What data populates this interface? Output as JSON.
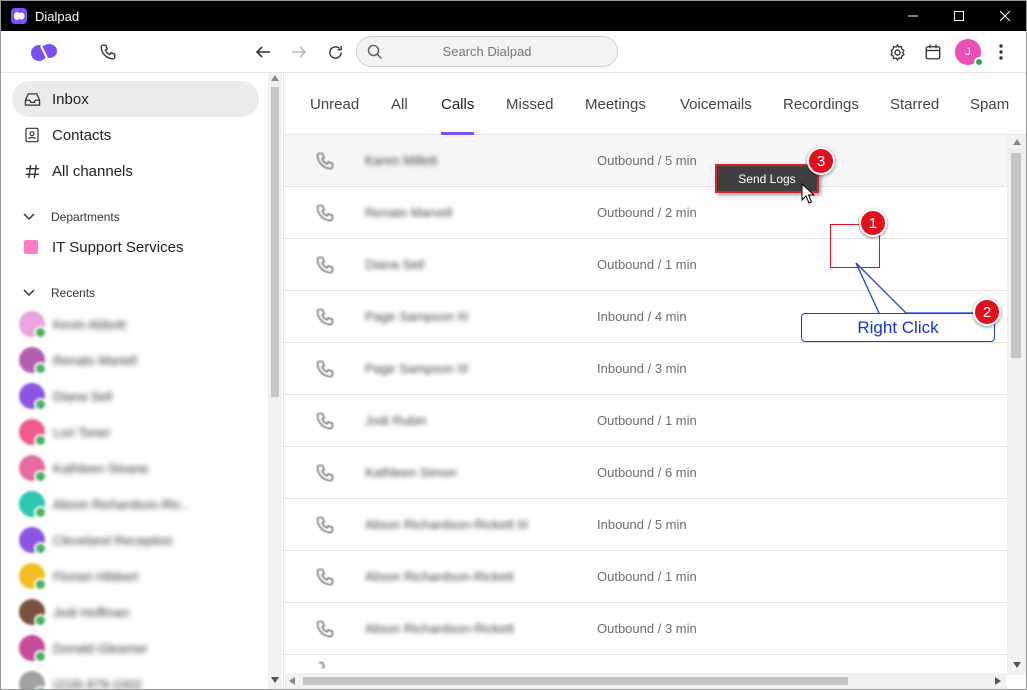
{
  "window": {
    "title": "Dialpad",
    "controls": [
      "minimize",
      "maximize",
      "close"
    ]
  },
  "toolbar": {
    "search_placeholder": "Search Dialpad",
    "avatar_initial": "J"
  },
  "sidebar": {
    "nav": [
      {
        "label": "Inbox",
        "icon": "inbox-icon",
        "active": true
      },
      {
        "label": "Contacts",
        "icon": "contacts-icon",
        "active": false
      },
      {
        "label": "All channels",
        "icon": "hash-icon",
        "active": false
      }
    ],
    "departments_heading": "Departments",
    "departments": [
      {
        "label": "IT Support Services",
        "color": "#ff7bc4"
      }
    ],
    "recents_heading": "Recents",
    "recents": [
      {
        "name": "Kevin Abbott",
        "color": "#e8a6e0"
      },
      {
        "name": "Renato Mariell",
        "color": "#b05fb0"
      },
      {
        "name": "Diana Sell",
        "color": "#8a55e0"
      },
      {
        "name": "Lori Toner",
        "color": "#f05a8f"
      },
      {
        "name": "Kathleen Sloane",
        "color": "#e76aa0"
      },
      {
        "name": "Alison Richardson-Ric..",
        "color": "#2cc7b0"
      },
      {
        "name": "Cleveland Reception",
        "color": "#8a55e0"
      },
      {
        "name": "Florian Hibbert",
        "color": "#f0c020"
      },
      {
        "name": "Jodi Hoffman",
        "color": "#7a5040"
      },
      {
        "name": "Donald Gleamer",
        "color": "#c84a9a"
      },
      {
        "name": "(218) 879-1002",
        "color": "#a0a0a0"
      }
    ]
  },
  "tabs": [
    {
      "label": "Unread",
      "active": false
    },
    {
      "label": "All",
      "active": false
    },
    {
      "label": "Calls",
      "active": true
    },
    {
      "label": "Missed",
      "active": false
    },
    {
      "label": "Meetings",
      "active": false
    },
    {
      "label": "Voicemails",
      "active": false
    },
    {
      "label": "Recordings",
      "active": false
    },
    {
      "label": "Starred",
      "active": false
    },
    {
      "label": "Spam",
      "active": false
    }
  ],
  "calls": [
    {
      "name": "Karen Millett",
      "status": "Outbound / 5 min"
    },
    {
      "name": "Renato Marvell",
      "status": "Outbound / 2 min"
    },
    {
      "name": "Diana Sell",
      "status": "Outbound / 1 min"
    },
    {
      "name": "Page Sampson III",
      "status": "Inbound / 4 min"
    },
    {
      "name": "Page Sampson III",
      "status": "Inbound / 3 min"
    },
    {
      "name": "Jodi Rubin",
      "status": "Outbound / 1 min"
    },
    {
      "name": "Kathleen Simon",
      "status": "Outbound / 6 min"
    },
    {
      "name": "Alison Richardson-Rickett III",
      "status": "Inbound / 5 min"
    },
    {
      "name": "Alison Richardson-Rickett",
      "status": "Outbound / 1 min"
    },
    {
      "name": "Alison Richardson-Rickett",
      "status": "Outbound / 3 min"
    }
  ],
  "annotations": {
    "context_menu_item": "Send Logs",
    "callout_text": "Right Click",
    "badges": [
      "1",
      "2",
      "3"
    ],
    "color_red": "#e0101e",
    "color_blue": "#1a3fe0"
  },
  "colors": {
    "accent": "#7b4ff0",
    "title_bar": "#000000"
  }
}
